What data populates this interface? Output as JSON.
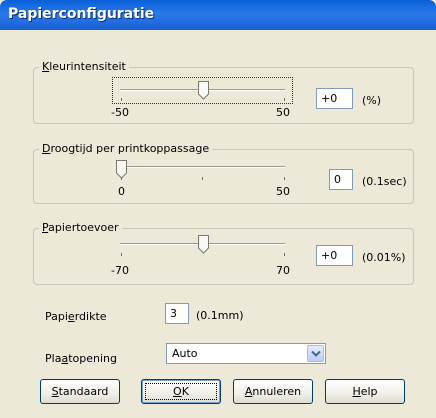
{
  "window": {
    "title": "Papierconfiguratie"
  },
  "color_density": {
    "label_key": "K",
    "label_rest": "leurintensiteit",
    "min_label": "-50",
    "max_label": "50",
    "value": "+0",
    "unit": "(%)"
  },
  "drying_time": {
    "label_key": "D",
    "label_rest": "roogtijd per printkoppassage",
    "min_label": "0",
    "max_label": "50",
    "value": "0",
    "unit": "(0.1sec)"
  },
  "paper_feed": {
    "label_key": "P",
    "label_rest": "apiertoevoer",
    "min_label": "-70",
    "max_label": "70",
    "value": "+0",
    "unit": "(0.01%)"
  },
  "thickness": {
    "label_pre": "Papi",
    "label_key": "e",
    "label_post": "rdikte",
    "value": "3",
    "unit": "(0.1mm)"
  },
  "platen_gap": {
    "label_pre": "Pla",
    "label_key": "a",
    "label_post": "topening",
    "selected": "Auto"
  },
  "buttons": {
    "standard_key": "S",
    "standard_rest": "tandaard",
    "ok_key": "O",
    "ok_rest": "K",
    "cancel_key": "A",
    "cancel_rest": "nnuleren",
    "help_key": "H",
    "help_rest": "elp"
  },
  "icons": {
    "slider_thumb": "slider-thumb-icon",
    "dropdown": "chevron-down-icon"
  },
  "colors": {
    "title_bar": "#0a5fd8",
    "dialog_bg": "#ece9d8",
    "button_border": "#003c74"
  }
}
